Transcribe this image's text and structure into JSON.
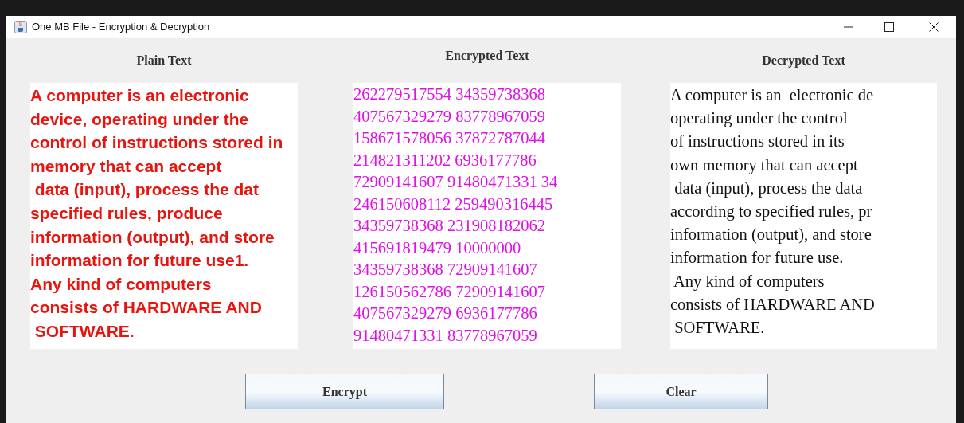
{
  "window": {
    "title": "One MB File - Encryption & Decryption"
  },
  "panels": [
    {
      "kind": "plain",
      "label": "Plain Text",
      "lines": [
        "A computer is an electronic",
        "device, operating under the",
        "control of instructions stored in",
        "memory that can accept",
        " data (input), process the dat",
        "specified rules, produce",
        "information (output), and store",
        "information for future use1.",
        "Any kind of computers",
        "consists of HARDWARE AND",
        " SOFTWARE."
      ]
    },
    {
      "kind": "encrypted",
      "label": "Encrypted Text",
      "lines": [
        "262279517554 34359738368",
        "407567329279 83778967059",
        "158671578056 37872787044",
        "214821311202 6936177786",
        "72909141607 91480471331 34",
        "246150608112 259490316445",
        "34359738368 231908182062",
        "415691819479 10000000",
        "34359738368 72909141607",
        "126150562786 72909141607",
        "407567329279 6936177786",
        "91480471331 83778967059"
      ]
    },
    {
      "kind": "decrypted",
      "label": "Decrypted Text",
      "lines": [
        "A computer is an  electronic de",
        "operating under the control",
        "of instructions stored in its",
        "own memory that can accept",
        " data (input), process the data",
        "according to specified rules, pr",
        "information (output), and store",
        "information for future use.",
        " Any kind of computers",
        "consists of HARDWARE AND",
        " SOFTWARE."
      ]
    }
  ],
  "buttons": [
    "Encrypt",
    "Clear"
  ]
}
